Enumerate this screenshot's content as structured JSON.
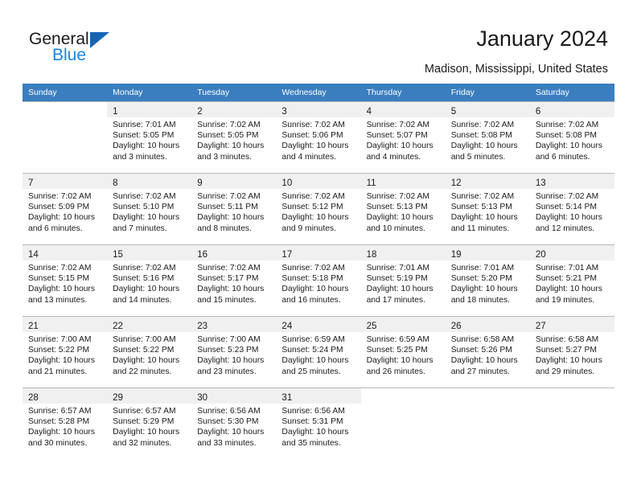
{
  "brand": {
    "name_part1": "General",
    "name_part2": "Blue",
    "triangle_color": "#1565b6",
    "blue_color": "#1a87e0"
  },
  "header": {
    "title": "January 2024",
    "subtitle": "Madison, Mississippi, United States"
  },
  "theme": {
    "header_row_bg": "#3a7ebf",
    "header_row_text": "#ffffff",
    "daynum_bar_bg": "#f0f0f0",
    "grid_line": "#b9b9b9",
    "cell_text": "#1a1a1a"
  },
  "calendar": {
    "weekday_headers": [
      "Sunday",
      "Monday",
      "Tuesday",
      "Wednesday",
      "Thursday",
      "Friday",
      "Saturday"
    ],
    "weeks": [
      [
        {
          "day": "",
          "lines": []
        },
        {
          "day": "1",
          "lines": [
            "Sunrise: 7:01 AM",
            "Sunset: 5:05 PM",
            "Daylight: 10 hours",
            "and 3 minutes."
          ]
        },
        {
          "day": "2",
          "lines": [
            "Sunrise: 7:02 AM",
            "Sunset: 5:05 PM",
            "Daylight: 10 hours",
            "and 3 minutes."
          ]
        },
        {
          "day": "3",
          "lines": [
            "Sunrise: 7:02 AM",
            "Sunset: 5:06 PM",
            "Daylight: 10 hours",
            "and 4 minutes."
          ]
        },
        {
          "day": "4",
          "lines": [
            "Sunrise: 7:02 AM",
            "Sunset: 5:07 PM",
            "Daylight: 10 hours",
            "and 4 minutes."
          ]
        },
        {
          "day": "5",
          "lines": [
            "Sunrise: 7:02 AM",
            "Sunset: 5:08 PM",
            "Daylight: 10 hours",
            "and 5 minutes."
          ]
        },
        {
          "day": "6",
          "lines": [
            "Sunrise: 7:02 AM",
            "Sunset: 5:08 PM",
            "Daylight: 10 hours",
            "and 6 minutes."
          ]
        }
      ],
      [
        {
          "day": "7",
          "lines": [
            "Sunrise: 7:02 AM",
            "Sunset: 5:09 PM",
            "Daylight: 10 hours",
            "and 6 minutes."
          ]
        },
        {
          "day": "8",
          "lines": [
            "Sunrise: 7:02 AM",
            "Sunset: 5:10 PM",
            "Daylight: 10 hours",
            "and 7 minutes."
          ]
        },
        {
          "day": "9",
          "lines": [
            "Sunrise: 7:02 AM",
            "Sunset: 5:11 PM",
            "Daylight: 10 hours",
            "and 8 minutes."
          ]
        },
        {
          "day": "10",
          "lines": [
            "Sunrise: 7:02 AM",
            "Sunset: 5:12 PM",
            "Daylight: 10 hours",
            "and 9 minutes."
          ]
        },
        {
          "day": "11",
          "lines": [
            "Sunrise: 7:02 AM",
            "Sunset: 5:13 PM",
            "Daylight: 10 hours",
            "and 10 minutes."
          ]
        },
        {
          "day": "12",
          "lines": [
            "Sunrise: 7:02 AM",
            "Sunset: 5:13 PM",
            "Daylight: 10 hours",
            "and 11 minutes."
          ]
        },
        {
          "day": "13",
          "lines": [
            "Sunrise: 7:02 AM",
            "Sunset: 5:14 PM",
            "Daylight: 10 hours",
            "and 12 minutes."
          ]
        }
      ],
      [
        {
          "day": "14",
          "lines": [
            "Sunrise: 7:02 AM",
            "Sunset: 5:15 PM",
            "Daylight: 10 hours",
            "and 13 minutes."
          ]
        },
        {
          "day": "15",
          "lines": [
            "Sunrise: 7:02 AM",
            "Sunset: 5:16 PM",
            "Daylight: 10 hours",
            "and 14 minutes."
          ]
        },
        {
          "day": "16",
          "lines": [
            "Sunrise: 7:02 AM",
            "Sunset: 5:17 PM",
            "Daylight: 10 hours",
            "and 15 minutes."
          ]
        },
        {
          "day": "17",
          "lines": [
            "Sunrise: 7:02 AM",
            "Sunset: 5:18 PM",
            "Daylight: 10 hours",
            "and 16 minutes."
          ]
        },
        {
          "day": "18",
          "lines": [
            "Sunrise: 7:01 AM",
            "Sunset: 5:19 PM",
            "Daylight: 10 hours",
            "and 17 minutes."
          ]
        },
        {
          "day": "19",
          "lines": [
            "Sunrise: 7:01 AM",
            "Sunset: 5:20 PM",
            "Daylight: 10 hours",
            "and 18 minutes."
          ]
        },
        {
          "day": "20",
          "lines": [
            "Sunrise: 7:01 AM",
            "Sunset: 5:21 PM",
            "Daylight: 10 hours",
            "and 19 minutes."
          ]
        }
      ],
      [
        {
          "day": "21",
          "lines": [
            "Sunrise: 7:00 AM",
            "Sunset: 5:22 PM",
            "Daylight: 10 hours",
            "and 21 minutes."
          ]
        },
        {
          "day": "22",
          "lines": [
            "Sunrise: 7:00 AM",
            "Sunset: 5:22 PM",
            "Daylight: 10 hours",
            "and 22 minutes."
          ]
        },
        {
          "day": "23",
          "lines": [
            "Sunrise: 7:00 AM",
            "Sunset: 5:23 PM",
            "Daylight: 10 hours",
            "and 23 minutes."
          ]
        },
        {
          "day": "24",
          "lines": [
            "Sunrise: 6:59 AM",
            "Sunset: 5:24 PM",
            "Daylight: 10 hours",
            "and 25 minutes."
          ]
        },
        {
          "day": "25",
          "lines": [
            "Sunrise: 6:59 AM",
            "Sunset: 5:25 PM",
            "Daylight: 10 hours",
            "and 26 minutes."
          ]
        },
        {
          "day": "26",
          "lines": [
            "Sunrise: 6:58 AM",
            "Sunset: 5:26 PM",
            "Daylight: 10 hours",
            "and 27 minutes."
          ]
        },
        {
          "day": "27",
          "lines": [
            "Sunrise: 6:58 AM",
            "Sunset: 5:27 PM",
            "Daylight: 10 hours",
            "and 29 minutes."
          ]
        }
      ],
      [
        {
          "day": "28",
          "lines": [
            "Sunrise: 6:57 AM",
            "Sunset: 5:28 PM",
            "Daylight: 10 hours",
            "and 30 minutes."
          ]
        },
        {
          "day": "29",
          "lines": [
            "Sunrise: 6:57 AM",
            "Sunset: 5:29 PM",
            "Daylight: 10 hours",
            "and 32 minutes."
          ]
        },
        {
          "day": "30",
          "lines": [
            "Sunrise: 6:56 AM",
            "Sunset: 5:30 PM",
            "Daylight: 10 hours",
            "and 33 minutes."
          ]
        },
        {
          "day": "31",
          "lines": [
            "Sunrise: 6:56 AM",
            "Sunset: 5:31 PM",
            "Daylight: 10 hours",
            "and 35 minutes."
          ]
        },
        {
          "day": "",
          "lines": []
        },
        {
          "day": "",
          "lines": []
        },
        {
          "day": "",
          "lines": []
        }
      ]
    ]
  }
}
